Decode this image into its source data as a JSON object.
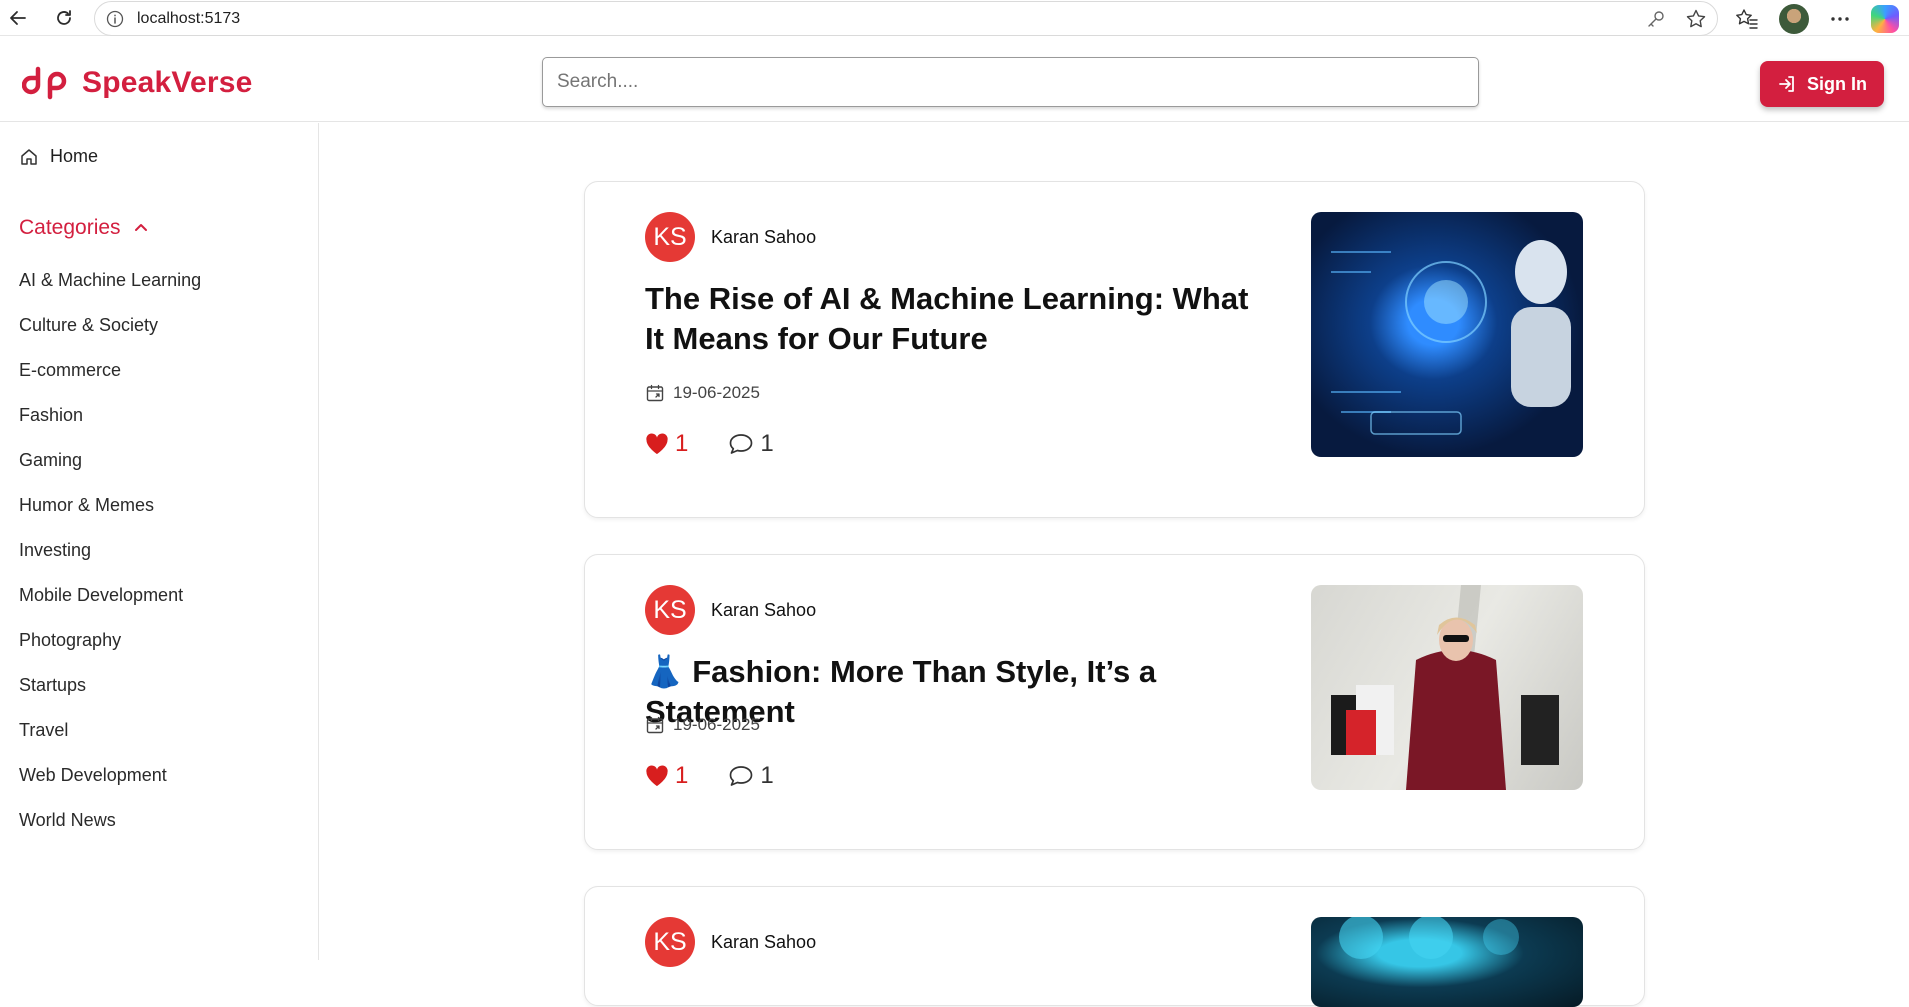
{
  "browser": {
    "url": "localhost:5173"
  },
  "header": {
    "brand": "SpeakVerse",
    "search_placeholder": "Search....",
    "signin_label": "Sign In",
    "accent_color": "#d31f3f"
  },
  "sidebar": {
    "home_label": "Home",
    "categories_label": "Categories",
    "categories": [
      "AI & Machine Learning",
      "Culture & Society",
      "E-commerce",
      "Fashion",
      "Gaming",
      "Humor & Memes",
      "Investing",
      "Mobile Development",
      "Photography",
      "Startups",
      "Travel",
      "Web Development",
      "World News"
    ]
  },
  "posts": [
    {
      "author_initials": "KS",
      "author_name": "Karan Sahoo",
      "title": "The Rise of AI & Machine Learning: What It Means for Our Future",
      "date": "19-06-2025",
      "likes": "1",
      "comments": "1",
      "image": "ai-robot-image"
    },
    {
      "author_initials": "KS",
      "author_name": "Karan Sahoo",
      "title": "👗 Fashion: More Than Style, It’s a Statement",
      "date": "19-06-2025",
      "likes": "1",
      "comments": "1",
      "image": "fashion-shopping-image"
    },
    {
      "author_initials": "KS",
      "author_name": "Karan Sahoo",
      "image": "web-development-image"
    }
  ]
}
